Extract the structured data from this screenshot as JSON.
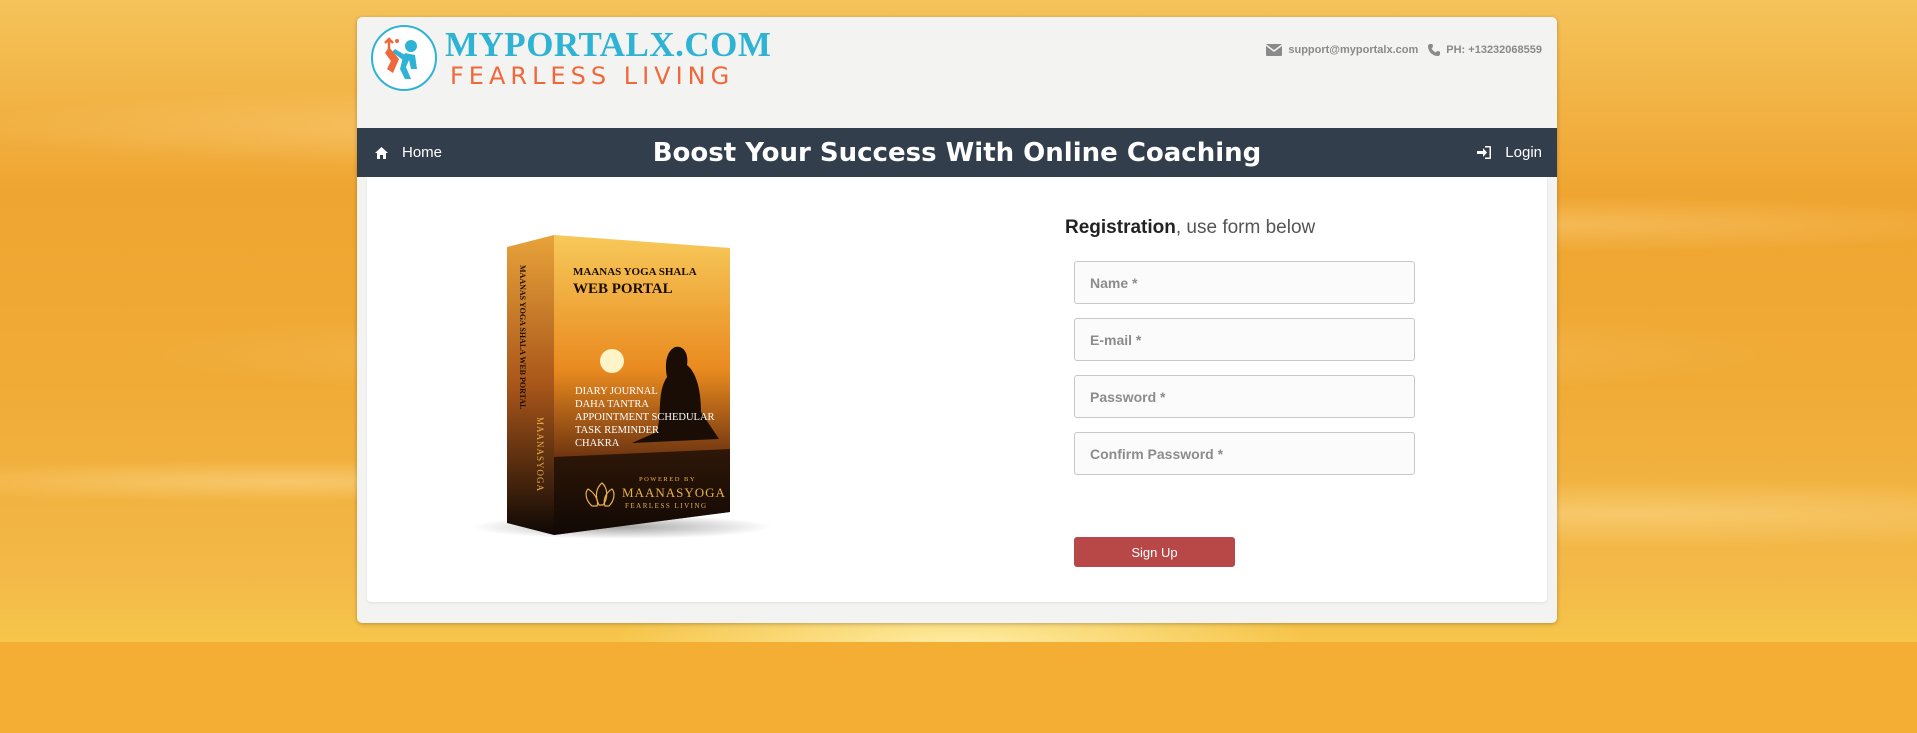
{
  "brand": {
    "title": "MYPORTALX.COM",
    "subtitle": "FEARLESS LIVING"
  },
  "contact": {
    "email": "support@myportalx.com",
    "phone": "PH: +13232068559"
  },
  "nav": {
    "home": "Home",
    "headline": "Boost Your Success With Online Coaching",
    "login": "Login"
  },
  "product_box": {
    "front_title_1": "MAANAS YOGA SHALA",
    "front_title_2": "WEB PORTAL",
    "features": [
      "DIARY JOURNAL",
      "DAHA TANTRA",
      "APPOINTMENT SCHEDULAR",
      "TASK REMINDER",
      "CHAKRA"
    ],
    "powered_by": "POWERED BY",
    "maker": "MAANASYOGA",
    "maker_sub": "FEARLESS LIVING",
    "spine_title": "MAANAS YOGA SHALA WEB PORTAL",
    "spine_maker": "MAANASYOGA"
  },
  "registration": {
    "heading_bold": "Registration",
    "heading_rest": ", use form below",
    "name_placeholder": "Name *",
    "email_placeholder": "E-mail *",
    "password_placeholder": "Password *",
    "confirm_placeholder": "Confirm Password *",
    "submit_label": "Sign Up"
  },
  "colors": {
    "brand_blue": "#2fb3d5",
    "brand_orange": "#f0683a",
    "navbar": "#323e4b",
    "button": "#b84848",
    "background": "#f2ae33"
  },
  "icons": {
    "email": "envelope-icon",
    "phone": "phone-icon",
    "home": "home-icon",
    "login": "sign-in-icon"
  }
}
